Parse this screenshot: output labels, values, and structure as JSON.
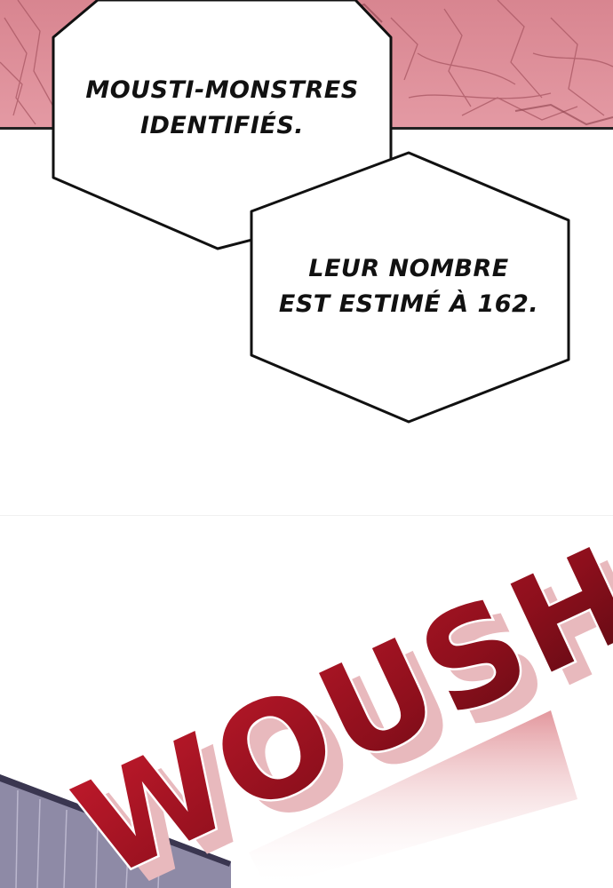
{
  "bubbles": [
    {
      "lines": [
        "MOUSTI-MONSTRES",
        "IDENTIFIÉS."
      ]
    },
    {
      "lines": [
        "LEUR NOMBRE",
        "EST ESTIMÉ À 162."
      ]
    }
  ],
  "sfx": {
    "text": "WOUSH"
  },
  "colors": {
    "panel_top": "#dd8c97",
    "panel_top_shade": "#b8636f",
    "panel_bottom": "#8c88a3",
    "sfx_red": "#a01422",
    "sfx_dark": "#5a0a12",
    "bubble_border": "#111111"
  }
}
